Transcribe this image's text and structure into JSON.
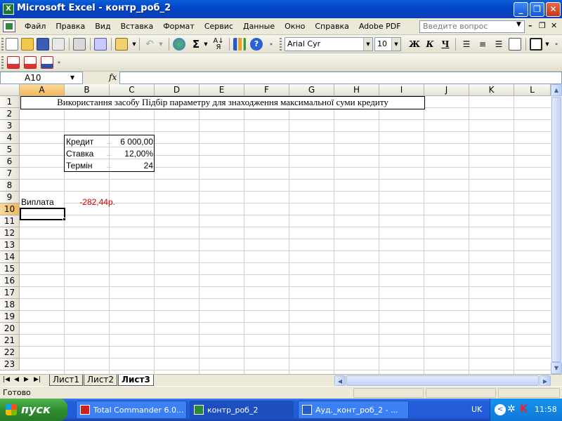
{
  "window": {
    "title": "Microsoft Excel - контр_роб_2",
    "minimize_label": "_",
    "restore_label": "❐",
    "close_label": "✕"
  },
  "menu": {
    "items": [
      "Файл",
      "Правка",
      "Вид",
      "Вставка",
      "Формат",
      "Сервис",
      "Данные",
      "Окно",
      "Справка",
      "Adobe PDF"
    ],
    "help_placeholder": "Введите вопрос"
  },
  "format_toolbar": {
    "font": "Arial Cyr",
    "size": "10",
    "bold": "Ж",
    "italic": "К",
    "underline": "Ч"
  },
  "formula_bar": {
    "name_box": "A10",
    "fx_label": "fx",
    "formula": ""
  },
  "columns": [
    "A",
    "B",
    "C",
    "D",
    "E",
    "F",
    "G",
    "H",
    "I",
    "J",
    "K",
    "L"
  ],
  "rows": [
    "1",
    "2",
    "3",
    "4",
    "5",
    "6",
    "7",
    "8",
    "9",
    "10",
    "11",
    "12",
    "13",
    "14",
    "15",
    "16",
    "17",
    "18",
    "19",
    "20",
    "21",
    "22",
    "23"
  ],
  "cells": {
    "A1": "Використання засобу Підбір параметру для знаходження максимальної суми кредиту",
    "B4": "Кредит",
    "C4": "6 000,00",
    "B5": "Ставка",
    "C5": "12,00%",
    "B6": "Термін",
    "C6": "24",
    "A9": "Виплата",
    "B9": "-282,44р.",
    "B9_color": "#cc0000"
  },
  "selected_cell": "A10",
  "sheet_tabs": [
    "Лист1",
    "Лист2",
    "Лист3"
  ],
  "active_sheet": "Лист3",
  "status": "Готово",
  "taskbar": {
    "start_label": "пуск",
    "tasks": [
      "Total Commander 6.0...",
      "контр_роб_2",
      "Ауд._конт_роб_2 - ..."
    ],
    "language": "UK",
    "clock": "11:58"
  }
}
